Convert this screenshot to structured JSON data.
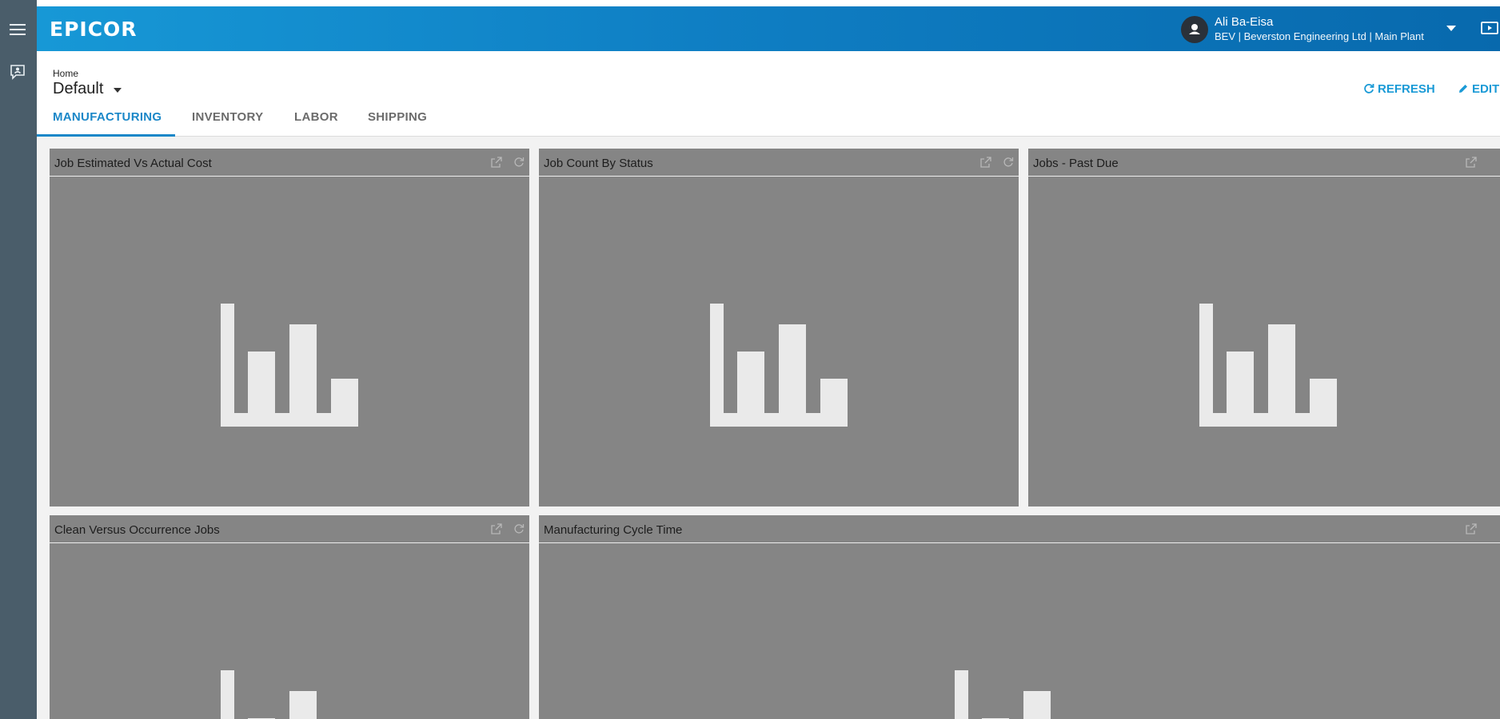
{
  "app": {
    "brand": "EPICOR"
  },
  "user": {
    "name": "Ali Ba-Eisa",
    "context": "BEV  |  Beverston Engineering Ltd  |  Main Plant"
  },
  "page": {
    "breadcrumb": "Home",
    "title": "Default"
  },
  "actions": {
    "refresh_label": "REFRESH",
    "edit_label": "EDIT"
  },
  "tabs": [
    {
      "label": "MANUFACTURING",
      "active": true
    },
    {
      "label": "INVENTORY",
      "active": false
    },
    {
      "label": "LABOR",
      "active": false
    },
    {
      "label": "SHIPPING",
      "active": false
    }
  ],
  "panels": [
    {
      "title": "Job Estimated Vs Actual Cost"
    },
    {
      "title": "Job Count By Status"
    },
    {
      "title": "Jobs - Past Due"
    },
    {
      "title": "Clean Versus Occurrence Jobs"
    },
    {
      "title": "Manufacturing Cycle Time"
    }
  ],
  "colors": {
    "header_gradient_start": "#1798d6",
    "header_gradient_end": "#0869ad",
    "accent": "#1a87c8",
    "rail": "#4a5d6a",
    "panel_bg": "#858585"
  }
}
